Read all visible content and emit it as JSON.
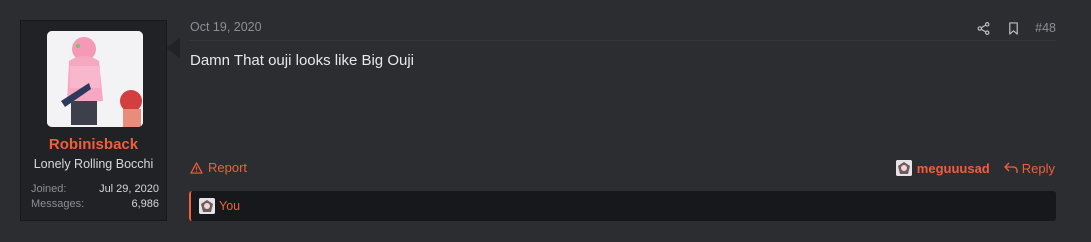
{
  "user": {
    "name": "Robinisback",
    "title": "Lonely Rolling Bocchi",
    "joined_label": "Joined:",
    "joined_value": "Jul 29, 2020",
    "messages_label": "Messages:",
    "messages_value": "6,986"
  },
  "post": {
    "date": "Oct 19, 2020",
    "number": "#48",
    "body": "Damn That ouji looks like Big Ouji"
  },
  "actions": {
    "report_label": "Report",
    "reacted_user": "meguuusad",
    "reply_label": "Reply"
  },
  "reactions": {
    "who": "You"
  },
  "icons": {
    "share": "share-icon",
    "bookmark": "bookmark-icon",
    "report": "warning-triangle-icon",
    "reply": "reply-arrow-icon"
  },
  "colors": {
    "accent": "#f05f3b",
    "background": "#2c2d30",
    "panel": "#212226",
    "muted": "#8d8e93"
  }
}
